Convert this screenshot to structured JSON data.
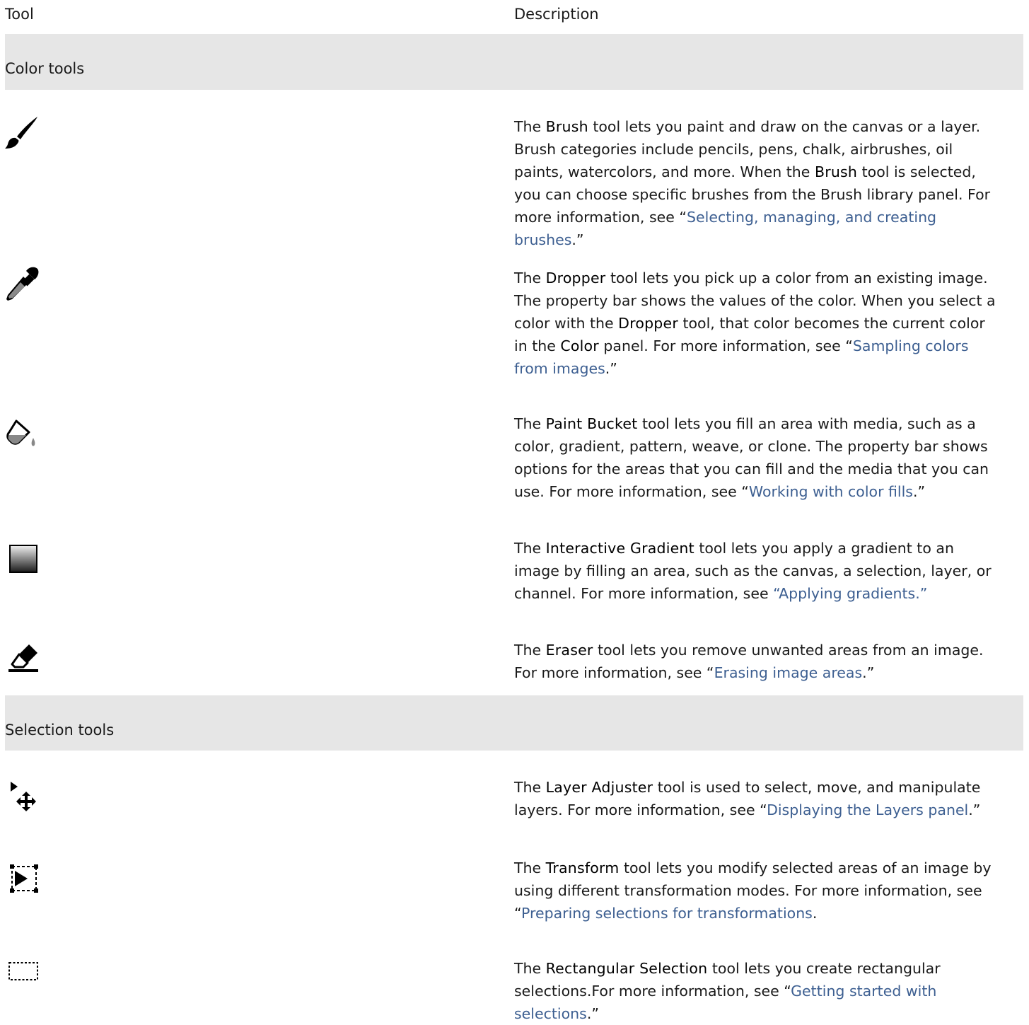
{
  "header": {
    "tool": "Tool",
    "description": "Description"
  },
  "sections": {
    "color": "Color tools",
    "selection": "Selection tools"
  },
  "rows": {
    "brush": {
      "icon": "brush-icon",
      "p1": "The ",
      "name1": "Brush",
      "p2": " tool lets you paint and draw on the canvas or a layer. Brush categories include pencils, pens, chalk, airbrushes, oil paints, watercolors, and more. When the ",
      "name2": "Brush",
      "p3": " tool is selected, you can choose specific brushes from the Brush library panel. For more information, see “",
      "link": "Selecting, managing, and creating brushes",
      "p4": ".”"
    },
    "dropper": {
      "icon": "dropper-icon",
      "p1": "The ",
      "name1": "Dropper",
      "p2": " tool lets you pick up a color from an existing image. The property bar shows the values of the color. When you select a color with the ",
      "name2": "Dropper",
      "p3": " tool, that color becomes the current color in the ",
      "name3": "Color",
      "p4": " panel. For more information, see “",
      "link": "Sampling colors from images",
      "p5": ".”"
    },
    "bucket": {
      "icon": "paint-bucket-icon",
      "p1": "The ",
      "name1": "Paint Bucket",
      "p2": " tool lets you fill an area with media, such as a color, gradient, pattern, weave, or clone. The property bar shows options for the areas that you can fill and the media that you can use. For more information, see “",
      "link": "Working with color fills",
      "p3": ".”"
    },
    "gradient": {
      "icon": "interactive-gradient-icon",
      "p1": "The ",
      "name1": "Interactive Gradient",
      "p2": " tool lets you apply a gradient to an image by filling an area, such as the canvas, a selection, layer, or channel. For more information, see ",
      "link": "“Applying gradients.”"
    },
    "eraser": {
      "icon": "eraser-icon",
      "p1": "The ",
      "name1": "Eraser",
      "p2": " tool lets you remove unwanted areas from an image. For more information, see “",
      "link": "Erasing image areas",
      "p3": ".”"
    },
    "layer_adjuster": {
      "icon": "layer-adjuster-icon",
      "p1": "The ",
      "name1": "Layer Adjuster",
      "p2": " tool is used to select, move, and manipulate layers. For more information, see “",
      "link": "Displaying the Layers panel",
      "p3": ".”"
    },
    "transform": {
      "icon": "transform-icon",
      "p1": "The ",
      "name1": "Transform",
      "p2": " tool lets you modify selected areas of an image by using different transformation modes. For more information, see “",
      "link": "Preparing selections for transformations",
      "p3": "."
    },
    "rect_select": {
      "icon": "rectangular-selection-icon",
      "p1": "The ",
      "name1": "Rectangular Selection",
      "p2": " tool lets you create rectangular selections.For more information, see “",
      "link": "Getting started with selections",
      "p3": ".”"
    }
  }
}
